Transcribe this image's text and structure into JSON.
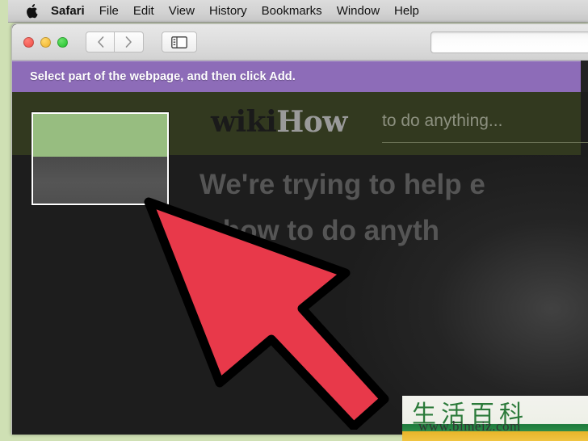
{
  "menubar": {
    "apple_icon": "apple-logo-icon",
    "items": [
      {
        "label": "Safari",
        "bold": true
      },
      {
        "label": "File",
        "bold": false
      },
      {
        "label": "Edit",
        "bold": false
      },
      {
        "label": "View",
        "bold": false
      },
      {
        "label": "History",
        "bold": false
      },
      {
        "label": "Bookmarks",
        "bold": false
      },
      {
        "label": "Window",
        "bold": false
      },
      {
        "label": "Help",
        "bold": false
      }
    ]
  },
  "window": {
    "traffic_lights": {
      "close_title": "Close",
      "minimize_title": "Minimize",
      "zoom_title": "Zoom"
    },
    "toolbar": {
      "back_icon": "chevron-left-icon",
      "forward_icon": "chevron-right-icon",
      "sidebar_icon": "sidebar-toggle-icon",
      "address_value": "",
      "address_placeholder": ""
    }
  },
  "notice": {
    "message": "Select part of the webpage, and then click Add.",
    "background_color": "#8d6cb8",
    "text_color": "#ffffff"
  },
  "webpage": {
    "header_background": "#32391f",
    "logo": {
      "part1": "wiki",
      "part2": "How",
      "part1_color": "#1a1a1a",
      "part2_color": "#9a9a9a"
    },
    "search": {
      "placeholder": "to do anything..."
    },
    "hero": {
      "line1": "We're trying to help e",
      "line2": "rn how to do anyth"
    },
    "body_background": "#1d1d1d"
  },
  "selection": {
    "border_color": "#ffffff",
    "top_fill_color": "#97bd80",
    "bottom_fill_color": "#4f4f4f"
  },
  "cursor": {
    "icon": "arrow-pointer-icon",
    "fill_color": "#e8394a",
    "outline_color": "#000000"
  },
  "watermark": {
    "cjk_text": "生活百科",
    "url": "www.bimeiz.com",
    "accent_green": "#2b7a3a",
    "accent_yellow": "#f0c442"
  }
}
